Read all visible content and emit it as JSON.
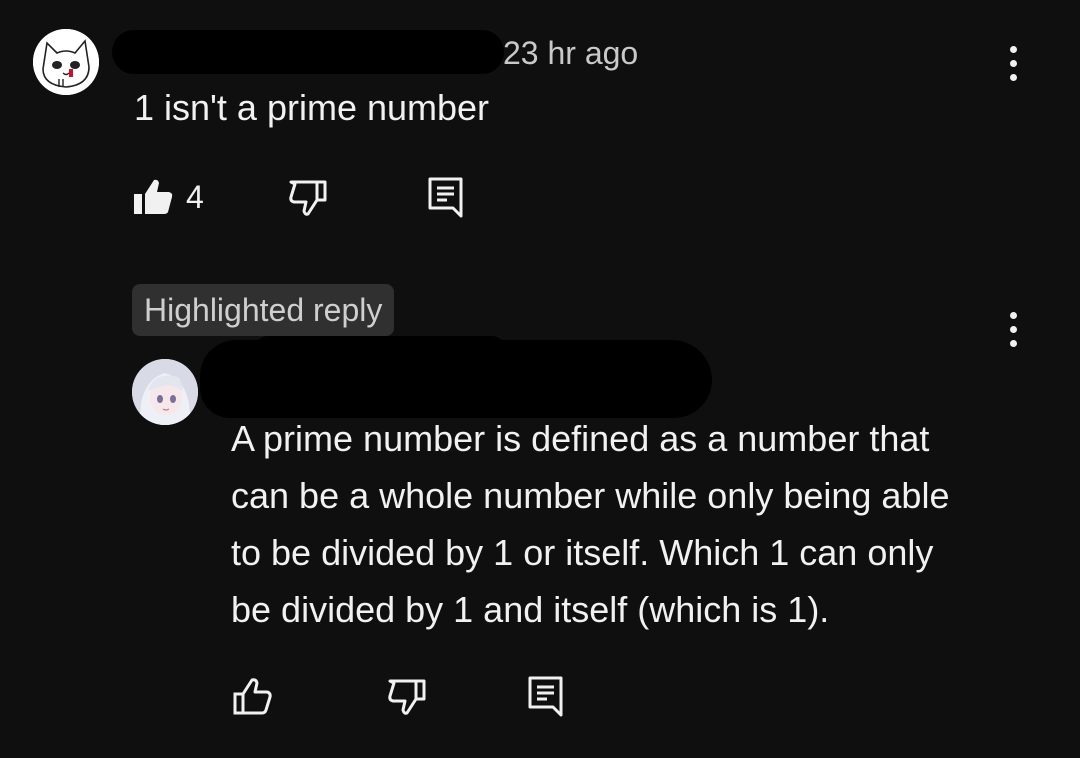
{
  "comment": {
    "timestamp": "23 hr ago",
    "text": "1 isn't a prime number",
    "like_count": "4"
  },
  "reply": {
    "badge": "Highlighted reply",
    "text_lines": [
      "A prime number is defined as a number that",
      "can be a whole number while only being able",
      "to be divided by 1 or itself. Which 1 can only",
      "be divided by 1 and itself (which is 1)."
    ]
  },
  "icons": {
    "like": "thumbs-up-icon",
    "dislike": "thumbs-down-icon",
    "reply": "reply-icon",
    "more": "more-vert-icon"
  },
  "colors": {
    "background": "#0f0f0f",
    "text": "#f1f1f1",
    "secondary_text": "#c9c9c9",
    "badge_bg": "#303030"
  }
}
